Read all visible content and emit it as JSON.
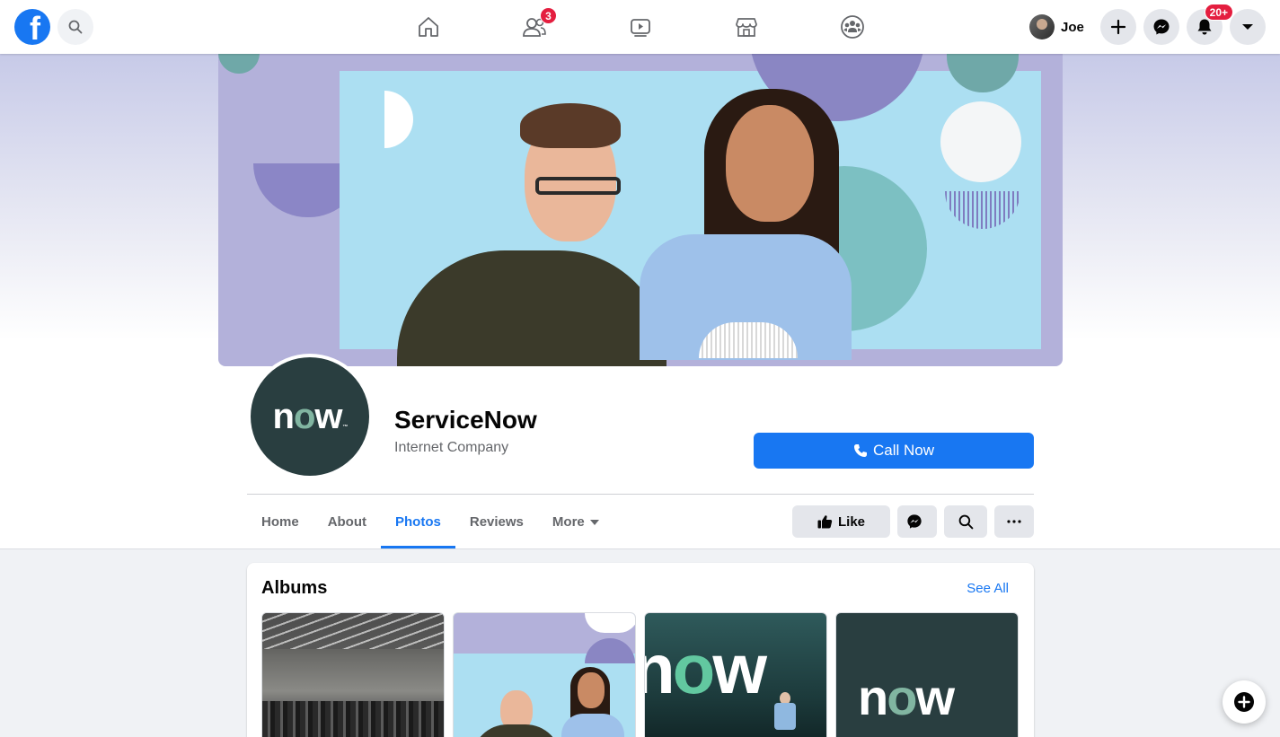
{
  "topbar": {
    "logo": "facebook-logo",
    "nav": [
      {
        "name": "home",
        "icon": "home-icon"
      },
      {
        "name": "friends",
        "icon": "friends-icon",
        "badge": "3"
      },
      {
        "name": "watch",
        "icon": "watch-icon"
      },
      {
        "name": "marketplace",
        "icon": "marketplace-icon"
      },
      {
        "name": "groups",
        "icon": "groups-icon"
      }
    ],
    "profile_name": "Joe",
    "notifications_badge": "20+"
  },
  "page": {
    "name": "ServiceNow",
    "category": "Internet Company",
    "call_button": "Call Now",
    "logo_text_n": "n",
    "logo_text_o": "o",
    "logo_text_w": "w",
    "logo_tm": "™"
  },
  "tabs": [
    {
      "label": "Home",
      "active": false
    },
    {
      "label": "About",
      "active": false
    },
    {
      "label": "Photos",
      "active": true
    },
    {
      "label": "Reviews",
      "active": false
    },
    {
      "label": "More",
      "active": false
    }
  ],
  "actions": {
    "like_label": "Like"
  },
  "albums": {
    "title": "Albums",
    "see_all": "See All",
    "thumb4_n": "n",
    "thumb4_o": "o",
    "thumb4_w": "w"
  },
  "colors": {
    "brand": "#1877f2",
    "badge": "#e41e3f",
    "servicenow_dark": "#293e40",
    "servicenow_green": "#81b5a1"
  }
}
